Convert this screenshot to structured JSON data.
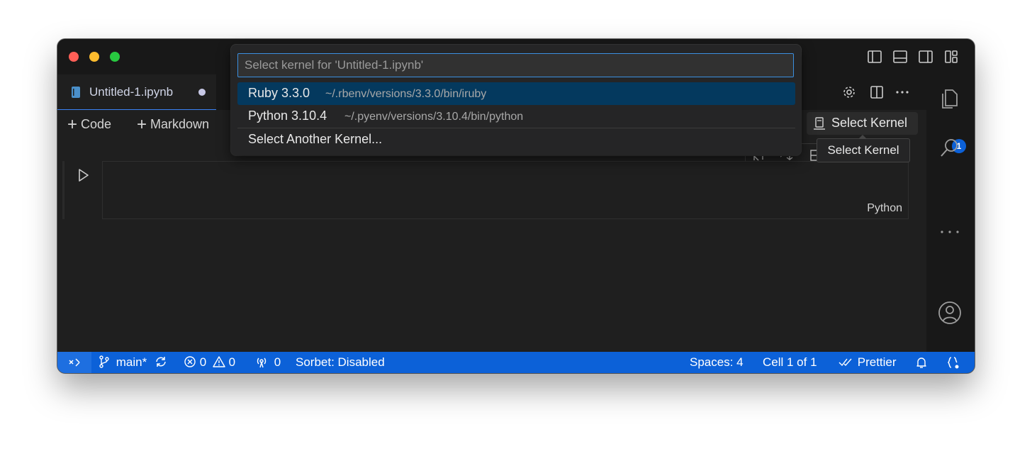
{
  "tab": {
    "title": "Untitled-1.ipynb"
  },
  "toolbar": {
    "code_label": "Code",
    "markdown_label": "Markdown",
    "kernel_label": "Select Kernel"
  },
  "quickpick": {
    "placeholder": "Select kernel for 'Untitled-1.ipynb'",
    "items": [
      {
        "label": "Ruby 3.3.0",
        "description": "~/.rbenv/versions/3.3.0/bin/iruby",
        "selected": true
      },
      {
        "label": "Python 3.10.4",
        "description": "~/.pyenv/versions/3.10.4/bin/python",
        "selected": false
      },
      {
        "label": "Select Another Kernel...",
        "description": "",
        "selected": false
      }
    ]
  },
  "tooltip": {
    "text": "Select Kernel"
  },
  "cell": {
    "language": "Python"
  },
  "activity": {
    "explorer_badge": "1"
  },
  "statusbar": {
    "branch": "main*",
    "errors": "0",
    "warnings": "0",
    "ports": "0",
    "sorbet": "Sorbet: Disabled",
    "spaces": "Spaces: 4",
    "cell": "Cell 1 of 1",
    "prettier": "Prettier"
  },
  "colors": {
    "status_bar": "#0c61d8",
    "accent": "#3b82f6",
    "selection": "#04395e",
    "badge": "#0c61d8",
    "traffic_red": "#ff5f57",
    "traffic_yellow": "#febc2e",
    "traffic_green": "#28c840"
  }
}
